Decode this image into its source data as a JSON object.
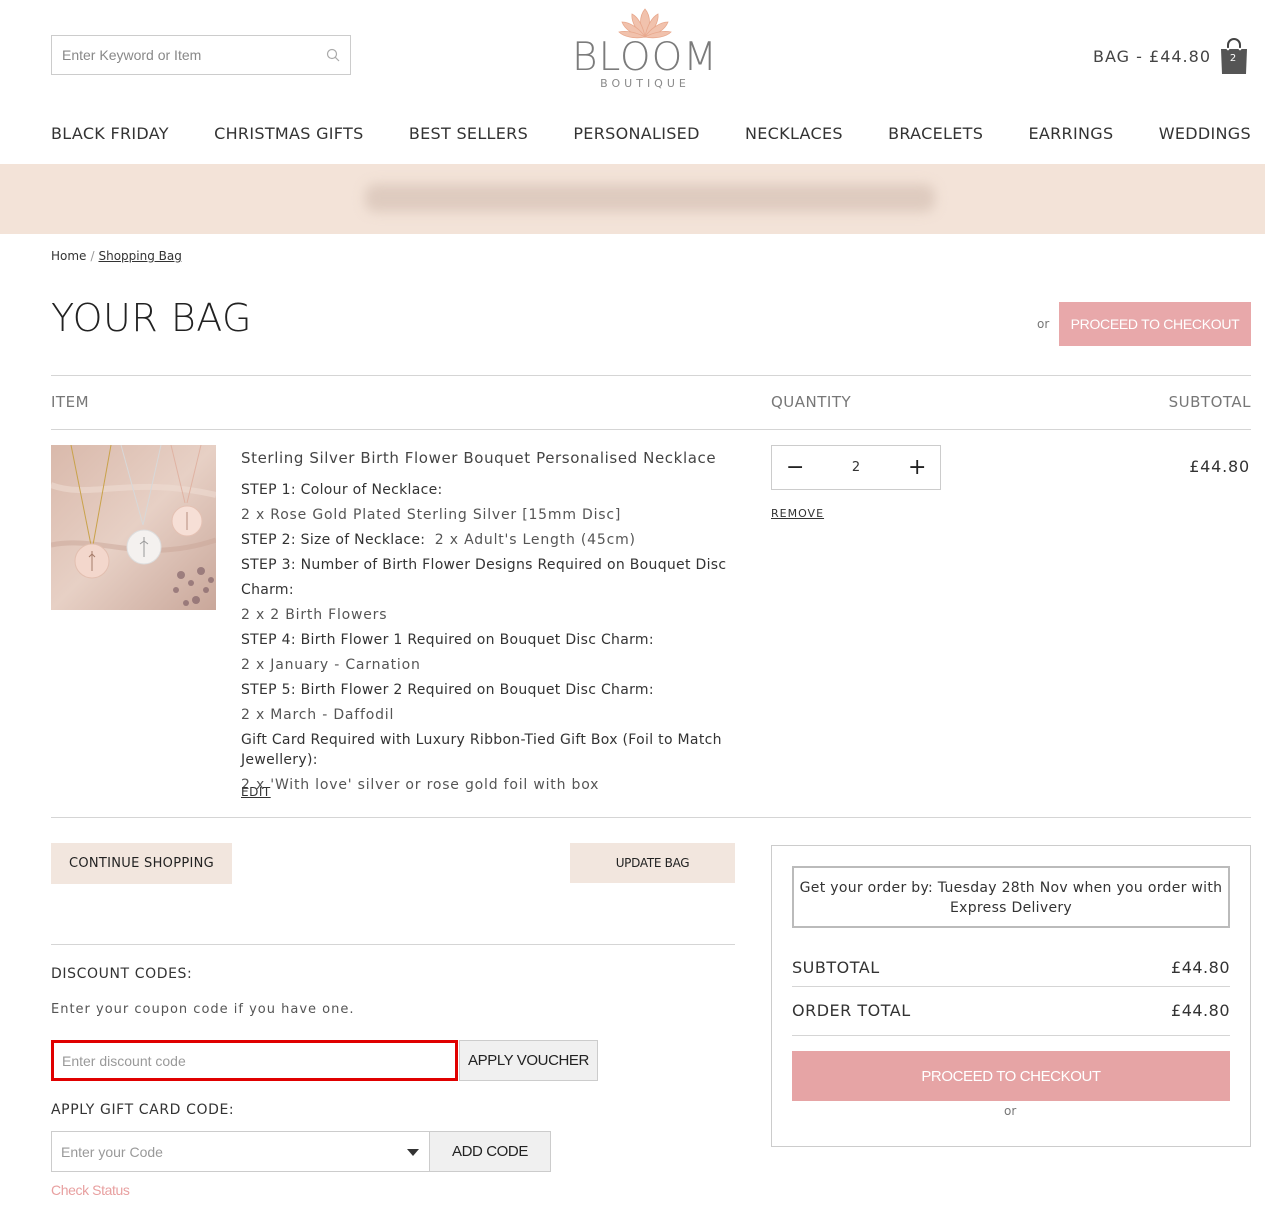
{
  "header": {
    "search_placeholder": "Enter Keyword or Item",
    "logo_word": "BLOOM",
    "logo_sub": "BOUTIQUE",
    "bag_text": "BAG - £44.80",
    "bag_count": "2"
  },
  "nav": [
    "BLACK FRIDAY",
    "CHRISTMAS GIFTS",
    "BEST SELLERS",
    "PERSONALISED",
    "NECKLACES",
    "BRACELETS",
    "EARRINGS",
    "WEDDINGS"
  ],
  "breadcrumb": {
    "home": "Home",
    "sep": "/",
    "current": "Shopping Bag"
  },
  "page": {
    "title": "YOUR BAG",
    "or": "or",
    "checkout_label": "PROCEED TO CHECKOUT"
  },
  "table": {
    "col_item": "ITEM",
    "col_quantity": "QUANTITY",
    "col_subtotal": "SUBTOTAL"
  },
  "line_item": {
    "name": "Sterling Silver Birth Flower Bouquet Personalised Necklace",
    "step1_label": "STEP 1: Colour of Necklace:",
    "step1_value": "2 x Rose Gold Plated Sterling Silver [15mm Disc]",
    "step2_label": "STEP 2: Size of Necklace:",
    "step2_value": "2 x Adult's Length (45cm)",
    "step3_label": "STEP 3: Number of Birth Flower Designs Required on Bouquet Disc Charm:",
    "step3_value": "2 x 2 Birth Flowers",
    "step4_label": "STEP 4: Birth Flower 1 Required on Bouquet Disc Charm:",
    "step4_value": "2 x January - Carnation",
    "step5_label": "STEP 5: Birth Flower 2 Required on Bouquet Disc Charm:",
    "step5_value": "2 x March - Daffodil",
    "gift_label": "Gift Card Required with Luxury Ribbon-Tied Gift Box (Foil to Match Jewellery):",
    "gift_value": "2 x 'With love' silver or rose gold foil with box",
    "edit": "EDIT",
    "quantity": "2",
    "minus": "−",
    "plus": "+",
    "remove": "REMOVE",
    "subtotal": "£44.80"
  },
  "actions": {
    "continue_shopping": "CONTINUE SHOPPING",
    "update_bag": "UPDATE BAG"
  },
  "discount": {
    "label": "DISCOUNT CODES:",
    "help": "Enter your coupon code if you have one.",
    "placeholder": "Enter discount code",
    "apply": "APPLY VOUCHER"
  },
  "giftcard": {
    "label": "APPLY GIFT CARD CODE:",
    "placeholder": "Enter your Code",
    "add": "ADD CODE",
    "check_status": "Check Status"
  },
  "summary": {
    "delivery_line1": "Get your order by: Tuesday 28th Nov when you order with",
    "delivery_line2": "Express Delivery",
    "subtotal_label": "SUBTOTAL",
    "subtotal_value": "£44.80",
    "total_label": "ORDER TOTAL",
    "total_value": "£44.80",
    "checkout_label": "PROCEED TO CHECKOUT",
    "or": "or"
  },
  "colors": {
    "accent_pink": "#e8a8aa",
    "beige": "#f2e6de",
    "banner": "#f3e3d8",
    "highlight_red": "#e00000"
  }
}
